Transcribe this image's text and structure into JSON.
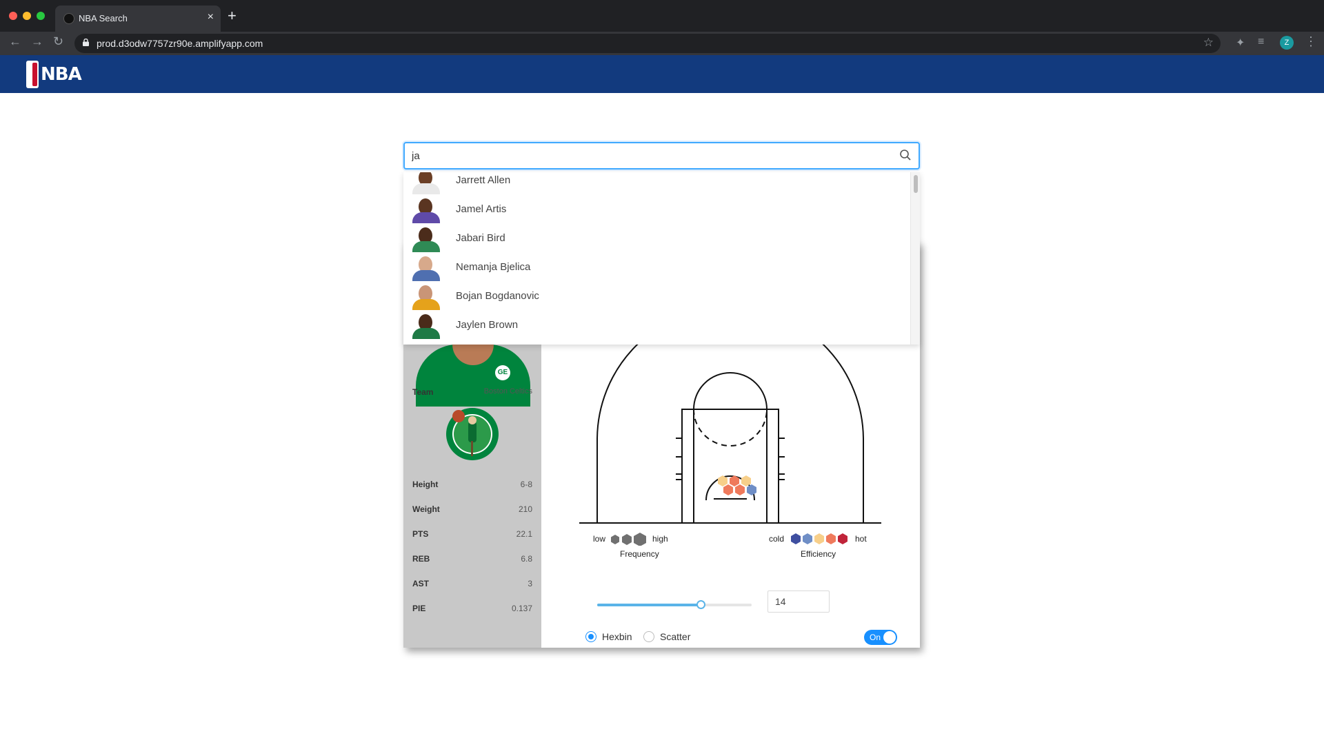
{
  "browser": {
    "tab_title": "NBA Search",
    "url": "prod.d3odw7757zr90e.amplifyapp.com",
    "profile_initial": "Z"
  },
  "search": {
    "value": "ja"
  },
  "dropdown": {
    "items": [
      {
        "name": "Jarrett Allen",
        "skin": "#6b3f26",
        "jersey": "#e9e9e9"
      },
      {
        "name": "Jamel Artis",
        "skin": "#5a3521",
        "jersey": "#5f4aa8"
      },
      {
        "name": "Jabari Bird",
        "skin": "#4b2c1b",
        "jersey": "#2f8a55"
      },
      {
        "name": "Nemanja Bjelica",
        "skin": "#d7a98b",
        "jersey": "#4f6fb0"
      },
      {
        "name": "Bojan Bogdanovic",
        "skin": "#c99577",
        "jersey": "#e5a21b"
      },
      {
        "name": "Jaylen Brown",
        "skin": "#4a2b1a",
        "jersey": "#1e7a45"
      }
    ]
  },
  "player": {
    "team_label": "Team",
    "team_value": "Boston Celtics",
    "stats": [
      {
        "label": "Height",
        "value": "6-8"
      },
      {
        "label": "Weight",
        "value": "210"
      },
      {
        "label": "PTS",
        "value": "22.1"
      },
      {
        "label": "REB",
        "value": "6.8"
      },
      {
        "label": "AST",
        "value": "3"
      },
      {
        "label": "PIE",
        "value": "0.137"
      }
    ]
  },
  "legend": {
    "frequency_low": "low",
    "frequency_high": "high",
    "frequency_title": "Frequency",
    "efficiency_cold": "cold",
    "efficiency_hot": "hot",
    "efficiency_title": "Efficiency",
    "efficiency_colors": [
      "#3f4fa0",
      "#6f8ec6",
      "#f7cf8a",
      "#ef7a5c",
      "#c0243a"
    ]
  },
  "controls": {
    "slider_fraction": 0.67,
    "number_value": "14",
    "radio_hexbin": "Hexbin",
    "radio_scatter": "Scatter",
    "selected": "Hexbin",
    "toggle_label": "On"
  }
}
